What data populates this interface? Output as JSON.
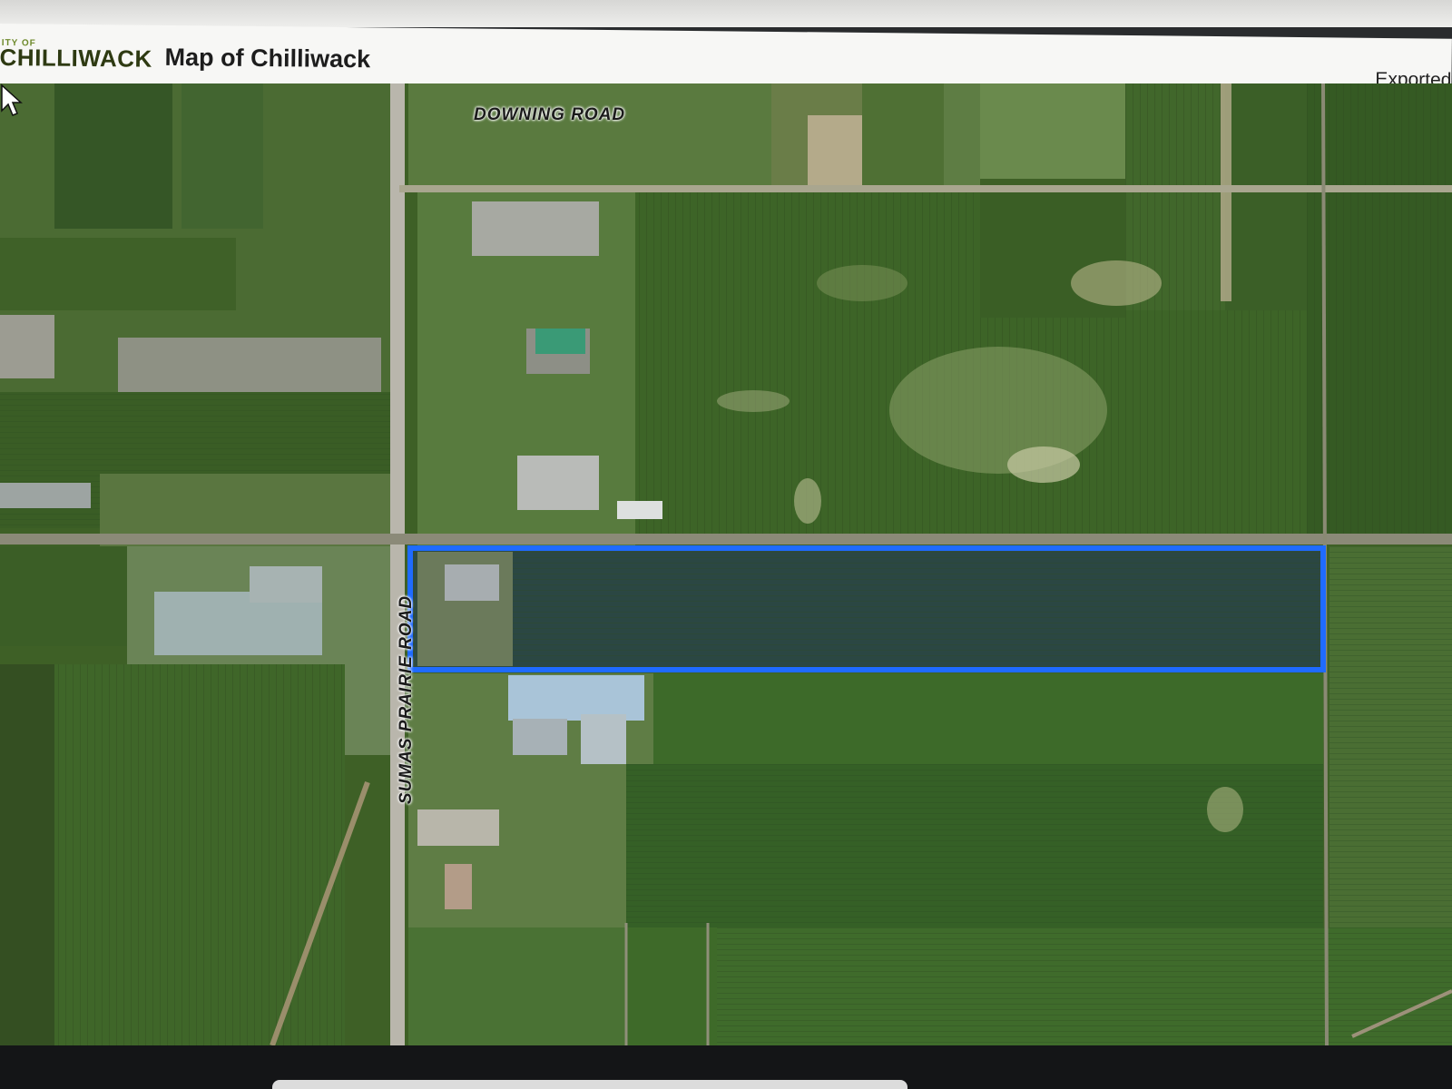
{
  "header": {
    "logo_small": "ITY OF",
    "logo_big": "CHILLIWACK",
    "title": "Map of Chilliwack",
    "export_label": "Exported"
  },
  "map": {
    "roads": {
      "downing": "DOWNING ROAD",
      "sumas": "SUMAS PRAIRIE ROAD"
    },
    "highlight_color": "#1f6bff",
    "imagery": "aerial satellite farmland"
  },
  "icons": {
    "cursor": "mouse-pointer-icon"
  }
}
